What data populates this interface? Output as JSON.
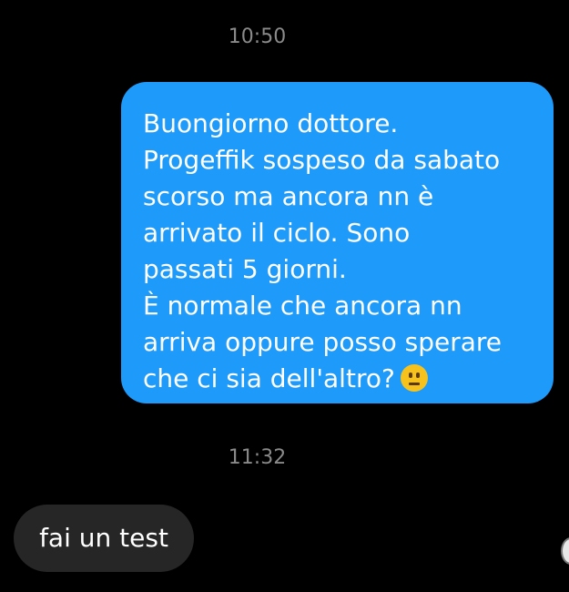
{
  "timestamps": {
    "first": "10:50",
    "second": "11:32"
  },
  "outgoing_message": {
    "lines": [
      "Buongiorno dottore.",
      "Progeffik sospeso da sabato",
      "scorso ma ancora nn è",
      "arrivato il ciclo. Sono",
      "passati 5 giorni.",
      "È normale che ancora nn",
      "arriva oppure posso sperare",
      "che ci sia dell'altro?"
    ],
    "emoji": "neutral-face-icon",
    "bubble_color": "#1e9bfa"
  },
  "incoming_message": {
    "text": "fai un test",
    "bubble_color": "#262626"
  }
}
